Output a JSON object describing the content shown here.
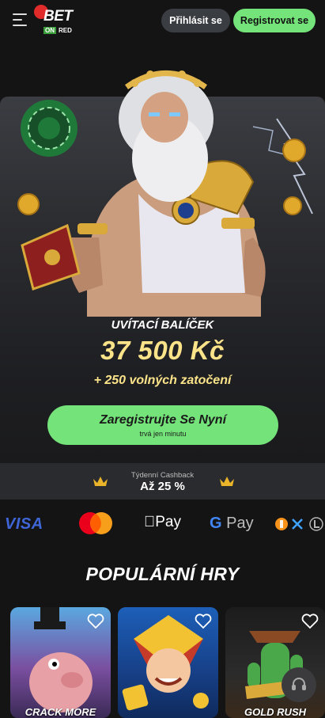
{
  "header": {
    "logo": {
      "bet": "BET",
      "on": "ON",
      "red": "RED"
    },
    "login_label": "Přihlásit se",
    "register_label": "Registrovat se"
  },
  "promo": {
    "title": "UVÍTACÍ BALÍČEK",
    "amount": "37 500 Kč",
    "spins": "+ 250 volných zatočení",
    "cta_label": "Zaregistrujte Se Nyní",
    "cta_sub": "trvá jen minutu"
  },
  "cashback": {
    "label": "Týdenní Cashback",
    "value": "Až 25 %"
  },
  "payments": {
    "visa": "VISA",
    "apple_pay": "Pay",
    "google_pay": "Pay",
    "google_g": "G"
  },
  "popular": {
    "title": "POPULÁRNÍ HRY",
    "games": [
      {
        "label": "CRACK MORE"
      },
      {
        "label": ""
      },
      {
        "label": "GOLD RUSH"
      }
    ]
  },
  "colors": {
    "accent_green": "#74e37a",
    "promo_yellow": "#fbe38a",
    "background": "#141414",
    "logo_red": "#e12b2b"
  },
  "icons": [
    "hamburger-menu-icon",
    "crown-icon",
    "heart-icon",
    "headset-icon",
    "apple-icon",
    "bitcoin-icon",
    "xrp-icon",
    "litecoin-icon"
  ]
}
